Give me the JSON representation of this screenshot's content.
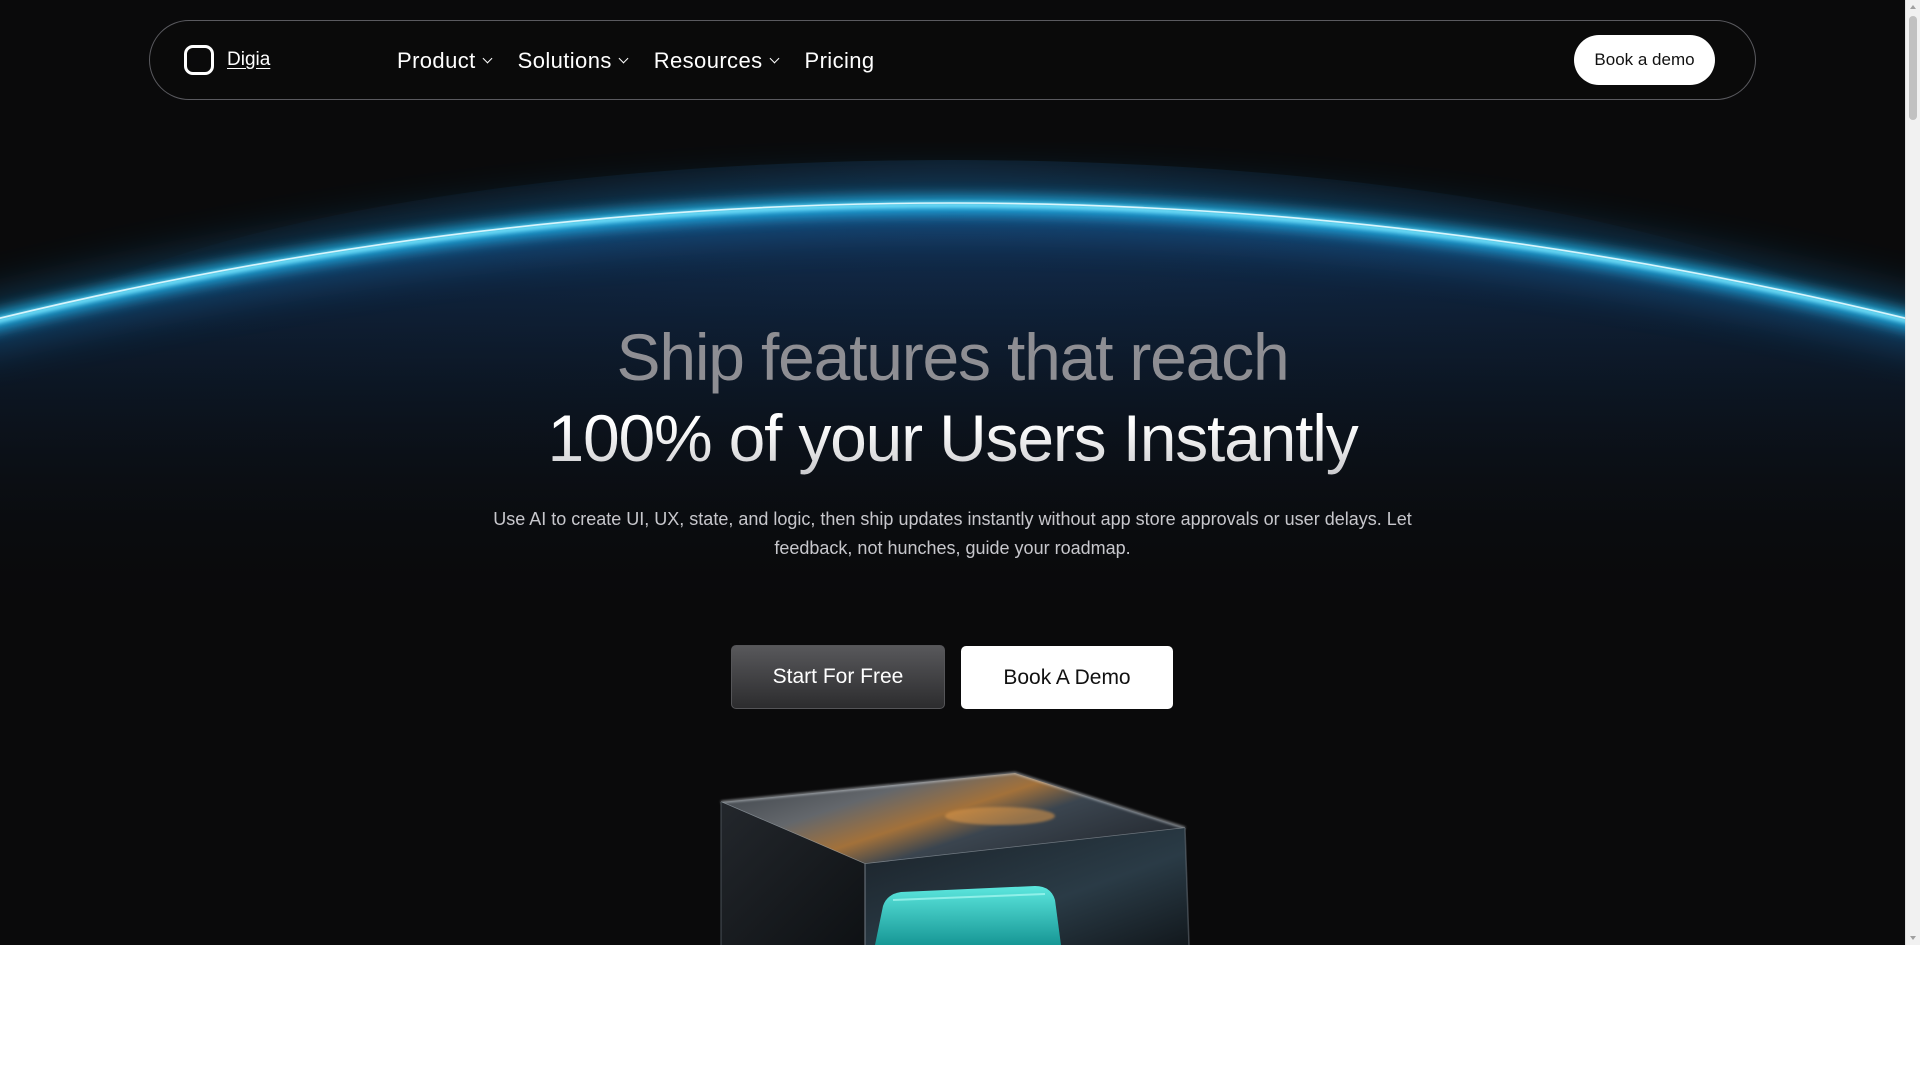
{
  "nav": {
    "logo_text": "Digia",
    "links": [
      {
        "label": "Product",
        "has_dropdown": true
      },
      {
        "label": "Solutions",
        "has_dropdown": true
      },
      {
        "label": "Resources",
        "has_dropdown": true
      },
      {
        "label": "Pricing",
        "has_dropdown": false
      }
    ],
    "cta_label": "Book a demo"
  },
  "hero": {
    "title_line_1": "Ship features that reach",
    "title_line_2": "100% of your Users Instantly",
    "subtitle": "Use AI to create UI, UX, state, and logic, then ship updates instantly without app store approvals or user delays. Let feedback, not hunches, guide your roadmap.",
    "primary_cta": "Start For Free",
    "secondary_cta": "Book A Demo"
  },
  "icons": [
    "logo-mark-icon",
    "chevron-down-icon",
    "glass-cube-illustration"
  ],
  "colors": {
    "background": "#0a0a0b",
    "horizon_glow": "#1ec8ff",
    "nav_border": "#5a5a5f",
    "title_muted": "#8e8e93",
    "text_light": "#c7c7cc"
  }
}
